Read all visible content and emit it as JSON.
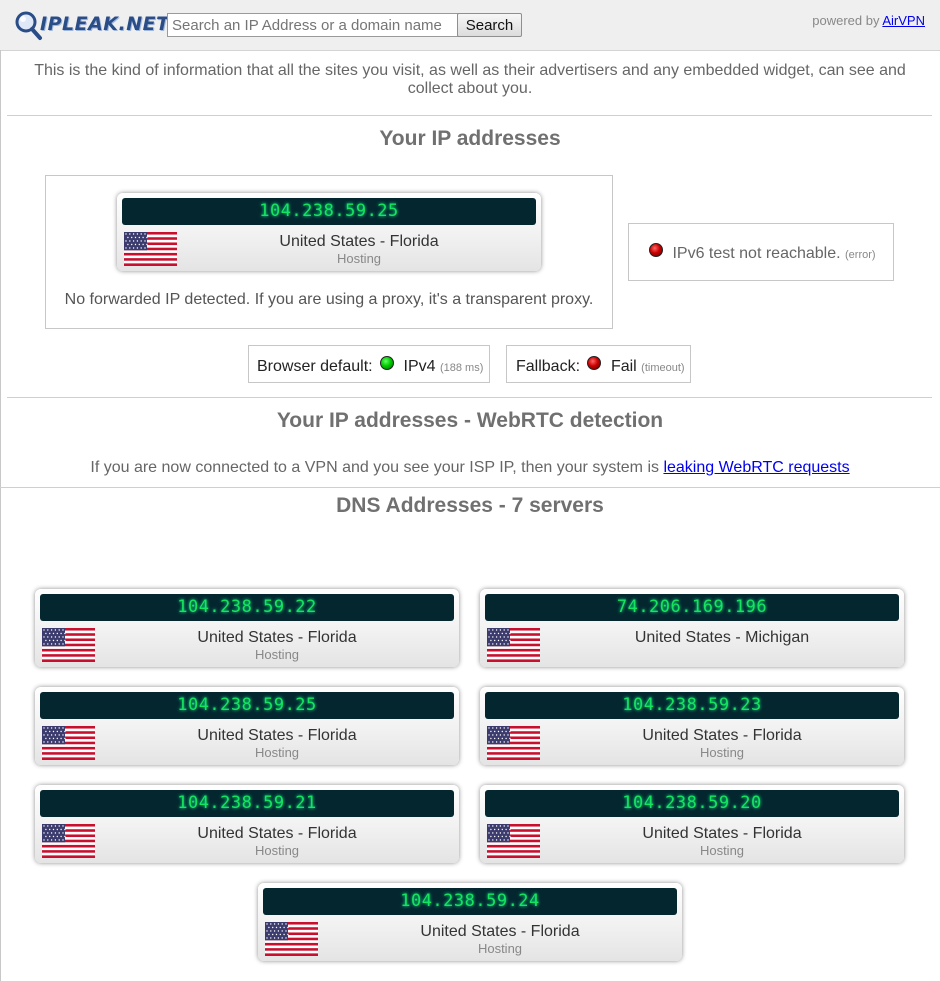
{
  "header": {
    "logo_text": "IPLEAK.NET",
    "search_placeholder": "Search an IP Address or a domain name",
    "search_value": "",
    "search_button": "Search",
    "powered_by": "powered by",
    "powered_link": "AirVPN"
  },
  "intro": "This is the kind of information that all the sites you visit, as well as their advertisers and any embedded widget, can see and collect about you.",
  "ip_section": {
    "title": "Your IP addresses",
    "main_ip": {
      "ip": "104.238.59.25",
      "location": "United States - Florida",
      "isp": "Hosting",
      "flag": "us-flag"
    },
    "no_forward": "No forwarded IP detected. If you are using a proxy, it's a transparent proxy.",
    "ipv6": {
      "text": "IPv6 test not reachable.",
      "status": "(error)",
      "color": "#cc0000"
    },
    "browser_default": {
      "label": "Browser default:",
      "value": "IPv4",
      "detail": "(188 ms)",
      "color": "#00cc00"
    },
    "fallback": {
      "label": "Fallback:",
      "value": "Fail",
      "detail": "(timeout)",
      "color": "#cc0000"
    }
  },
  "webrtc_section": {
    "title": "Your IP addresses - WebRTC detection",
    "text": "If you are now connected to a VPN and you see your ISP IP, then your system is",
    "link": "leaking WebRTC requests"
  },
  "dns_section": {
    "title": "DNS Addresses - 7 servers",
    "servers": [
      {
        "ip": "104.238.59.22",
        "location": "United States - Florida",
        "isp": "Hosting"
      },
      {
        "ip": "74.206.169.196",
        "location": "United States - Michigan",
        "isp": ""
      },
      {
        "ip": "104.238.59.25",
        "location": "United States - Florida",
        "isp": "Hosting"
      },
      {
        "ip": "104.238.59.23",
        "location": "United States - Florida",
        "isp": "Hosting"
      },
      {
        "ip": "104.238.59.21",
        "location": "United States - Florida",
        "isp": "Hosting"
      },
      {
        "ip": "104.238.59.20",
        "location": "United States - Florida",
        "isp": "Hosting"
      },
      {
        "ip": "104.238.59.24",
        "location": "United States - Florida",
        "isp": "Hosting"
      }
    ]
  },
  "colors": {
    "ip_bar": "#04272f",
    "ip_text": "#19e35e",
    "link": "#0000ee"
  }
}
